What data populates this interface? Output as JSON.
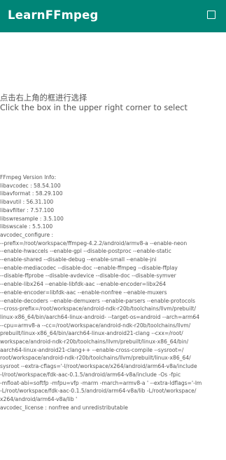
{
  "app_bar": {
    "title": "LearnFFmpeg",
    "menu_icon": "checkbox-square-icon",
    "background": "#008577"
  },
  "hint": {
    "zh": "点击右上角的框进行选择",
    "en": "Click the box in the upper right corner to select"
  },
  "version_info": "FFmpeg Version Info:\nlibavcodec : 58.54.100\nlibavformat : 58.29.100\nlibavutil : 56.31.100\nlibavfilter : 7.57.100\nlibswresample : 3.5.100\nlibswscale : 5.5.100\navcodec_configure :\n--prefix=/root/workspace/ffmpeg-4.2.2/android/armv8-a --enable-neon\n--enable-hwaccels --enable-gpl --disable-postproc --enable-static\n--enable-shared --disable-debug --enable-small --enable-jni\n--enable-mediacodec --disable-doc --enable-ffmpeg --disable-ffplay\n--disable-ffprobe --disable-avdevice --disable-doc --disable-symver\n--enable-libx264 --enable-libfdk-aac --enable-encoder=libx264\n--enable-encoder=libfdk-aac --enable-nonfree --enable-muxers\n--enable-decoders --enable-demuxers --enable-parsers --enable-protocols\n--cross-prefix=/root/workspace/android-ndk-r20b/toolchains/llvm/prebuilt/\nlinux-x86_64/bin/aarch64-linux-android- --target-os=android --arch=arm64\n--cpu=armv8-a --cc=/root/workspace/android-ndk-r20b/toolchains/llvm/\nprebuilt/linux-x86_64/bin/aarch64-linux-android21-clang --cxx=/root/\nworkspace/android-ndk-r20b/toolchains/llvm/prebuilt/linux-x86_64/bin/\naarch64-linux-android21-clang++ --enable-cross-compile --sysroot=/\nroot/workspace/android-ndk-r20b/toolchains/llvm/prebuilt/linux-x86_64/\nsysroot --extra-cflags='-I/root/workspace/x264/android/arm64-v8a/include\n-I/root/workspace/fdk-aac-0.1.5/android/arm64-v8a/include -Os -fpic\n-mfloat-abi=softfp -mfpu=vfp -marm -march=armv8-a ' --extra-ldflags='-lm\n-L/root/workspace/fdk-aac-0.1.5/android/arm64-v8a/lib -L/root/workspace/\nx264/android/arm64-v8a/lib '\navcodec_license : nonfree and unredistributable"
}
